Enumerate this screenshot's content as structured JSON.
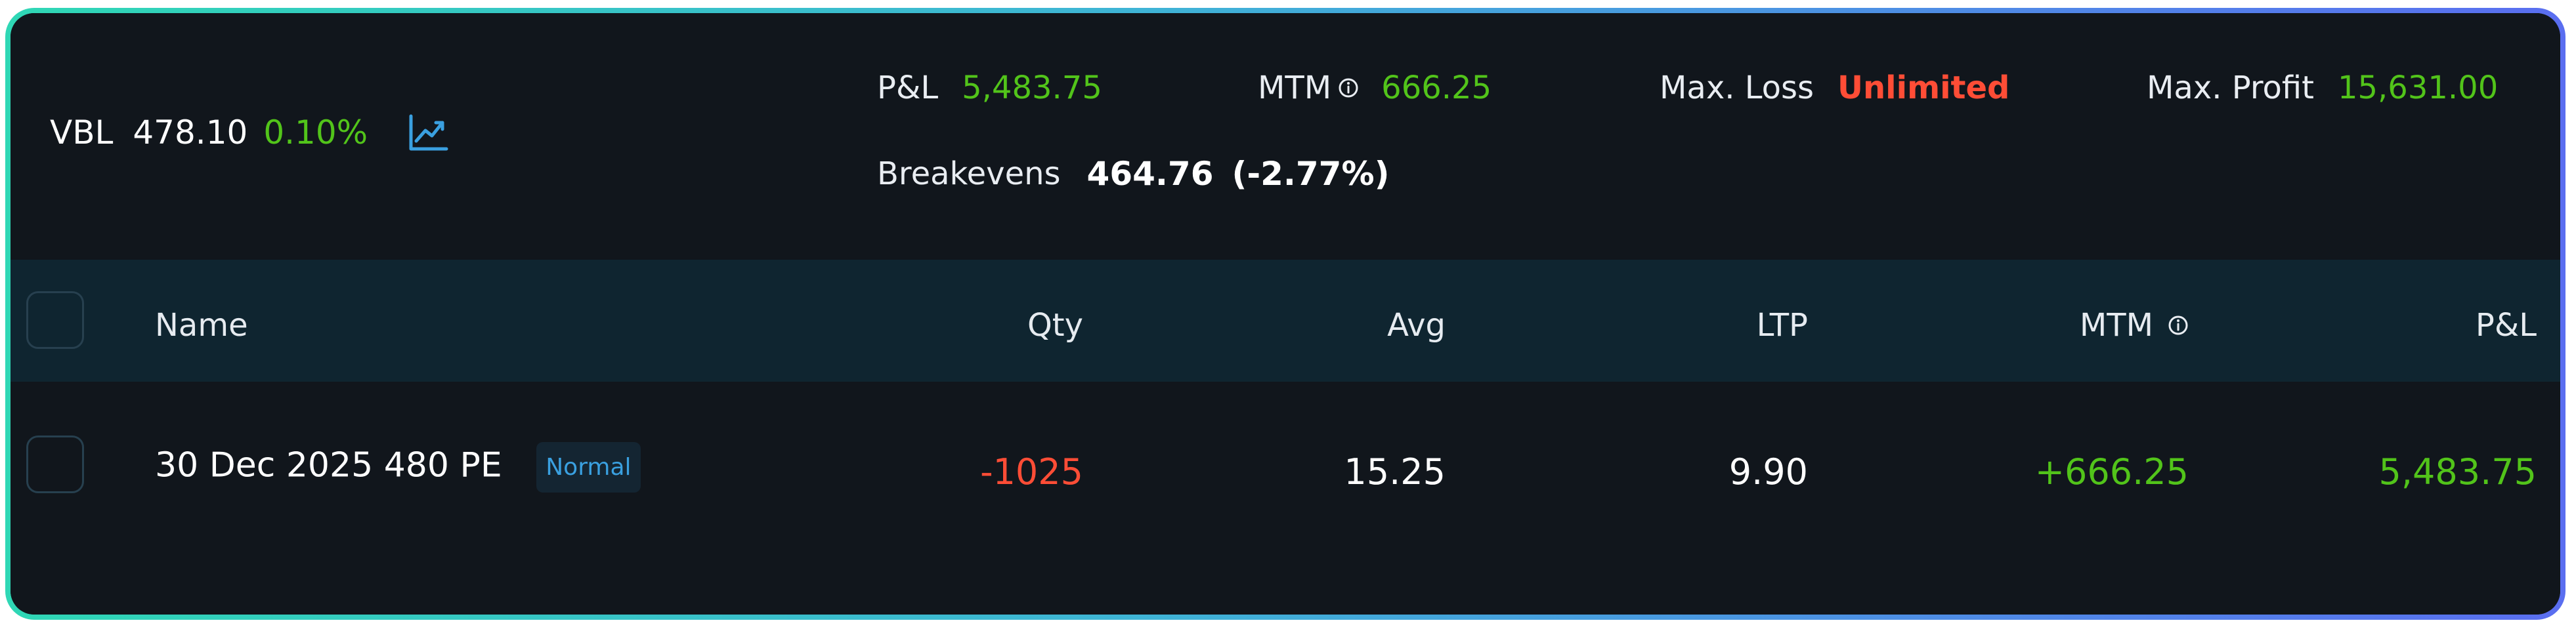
{
  "ticker": {
    "symbol": "VBL",
    "price": "478.10",
    "change": "0.10%",
    "chart_icon": "trend-chart-icon"
  },
  "summary": {
    "pnl_label": "P&L",
    "pnl_value": "5,483.75",
    "mtm_label": "MTM",
    "mtm_value": "666.25",
    "max_loss_label": "Max. Loss",
    "max_loss_value": "Unlimited",
    "max_profit_label": "Max. Profit",
    "max_profit_value": "15,631.00",
    "breakevens_label": "Breakevens",
    "breakevens_value": "464.76",
    "breakevens_pct": "(-2.77%)"
  },
  "table": {
    "columns": {
      "name": "Name",
      "qty": "Qty",
      "avg": "Avg",
      "ltp": "LTP",
      "mtm": "MTM",
      "pnl": "P&L"
    },
    "rows": [
      {
        "name": "30 Dec 2025 480 PE",
        "badge": "Normal",
        "qty": "-1025",
        "avg": "15.25",
        "ltp": "9.90",
        "mtm": "+666.25",
        "pnl": "5,483.75"
      }
    ]
  },
  "colors": {
    "positive": "#52c41a",
    "negative": "#ff4d36",
    "accent": "#3aa0e0",
    "background": "#11161c",
    "header_bg": "#0f2530"
  }
}
